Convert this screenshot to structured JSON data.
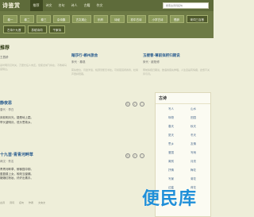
{
  "header": {
    "logo": "诗鉴赏",
    "nav": [
      "推荐",
      "诗文",
      "名句",
      "诗人",
      "古籍",
      "作文"
    ],
    "search_placeholder": "搜索古诗词名句"
  },
  "tags": {
    "row1": [
      "卷一",
      "卷二",
      "卷三",
      "杂诗集",
      "古文观止",
      "乐府",
      "诗经",
      "初中古诗",
      "小学古诗",
      "楚辞"
    ],
    "row2": [
      "宋词三百首",
      "古诗十九首",
      "苏轼诗词",
      "千家诗"
    ]
  },
  "section": {
    "title": "推荐"
  },
  "cards": [
    {
      "title": "",
      "meta": "王昌龄",
      "text": "秦时明月汉时关，万里长征人未还。但使龙城飞将在，不教胡马度阴山。"
    },
    {
      "title": "踏莎行·郴州旅舍",
      "meta": "宋代 · 秦观",
      "text": "雾失楼台，月迷津渡，桃源望断无寻处。可堪孤馆闭春寒，杜鹃声里斜阳暮。"
    },
    {
      "title": "玉楼春·尊前拟把归期说",
      "meta": "宋代 · 欧阳修",
      "text": "尊前拟把归期说，欲语春容先惨咽。人生自是有情痴，此恨不关风与月。"
    }
  ],
  "poems": [
    {
      "title": "静夜思",
      "meta": "唐代 · 李白",
      "lines": [
        "床前明月光，疑是地上霜。",
        "举头望明月，低头思故乡。"
      ]
    },
    {
      "title": "十九首·青青河畔草",
      "meta": "两汉 · 佚名",
      "lines": [
        "青青河畔草，郁郁园中柳。",
        "盈盈楼上女，皎皎当窗牖。",
        "娥娥红粉妆，纤纤出素手。"
      ]
    }
  ],
  "right_panel": {
    "title": "古诗",
    "col1": [
      "写人",
      "咏物",
      "春天",
      "夏天",
      "思乡",
      "爱国",
      "离别",
      "抒情",
      "写景",
      "边塞"
    ],
    "col2": [
      "山水",
      "田园",
      "秋天",
      "冬天",
      "友情",
      "写雨",
      "月亮",
      "梅花",
      "菊花",
      "荷花"
    ]
  },
  "watermark": "便民库",
  "footer": [
    "古诗",
    "诗词",
    "名句",
    "作者",
    "文言文"
  ]
}
